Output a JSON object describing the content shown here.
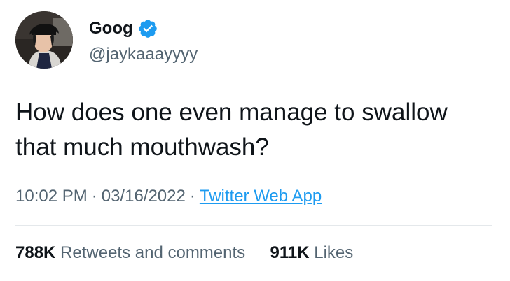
{
  "author": {
    "display_name": "Goog",
    "handle": "@jaykaaayyyy",
    "verified_icon": "verified-badge-icon",
    "avatar_icon": "profile-photo"
  },
  "tweet": {
    "text": "How does one even manage to swallow that much mouthwash?"
  },
  "meta": {
    "time": "10:02 PM",
    "separator": "·",
    "date": "03/16/2022",
    "source": "Twitter Web App"
  },
  "stats": {
    "retweets_count": "788K",
    "retweets_label": "Retweets and comments",
    "likes_count": "911K",
    "likes_label": "Likes"
  },
  "colors": {
    "verified_blue": "#1d9bf0",
    "text_primary": "#0f1419",
    "text_secondary": "#536471",
    "divider": "#e4e8eb"
  }
}
